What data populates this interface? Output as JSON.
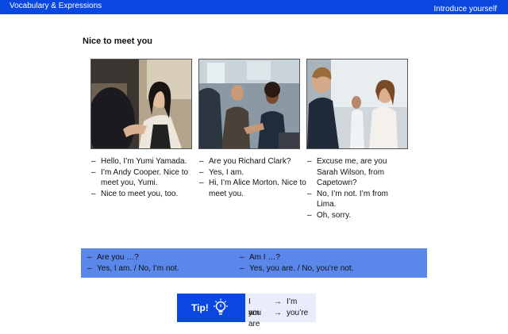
{
  "header": {
    "section_title": "Vocabulary & Expressions",
    "lesson_title": "Introduce yourself"
  },
  "heading": "Nice to meet you",
  "colors": {
    "brand": "#0a47e0",
    "grammar_bg": "#5b87ea",
    "tip_bg": "#e9edfb"
  },
  "dialogues": [
    {
      "lines": [
        "Hello, I’m Yumi Yamada.",
        "I’m Andy Cooper. Nice to meet you, Yumi.",
        "Nice to meet you, too."
      ]
    },
    {
      "lines": [
        "Are you Richard Clark?",
        "Yes, I am.",
        "Hi, I’m Alice Morton. Nice to meet you."
      ]
    },
    {
      "lines": [
        "Excuse me, are you Sarah Wilson, from Capetown?",
        "No, I’m not. I’m from Lima.",
        "Oh, sorry."
      ]
    }
  ],
  "grammar": {
    "left": [
      "Are you …?",
      "Yes, I am. / No, I’m not."
    ],
    "right": [
      "Am I …?",
      "Yes, you are. / No, you’re not."
    ]
  },
  "tip": {
    "label": "Tip!",
    "icon": "lightbulb-icon",
    "rows": [
      {
        "from": "I am",
        "arrow": "→",
        "to": "I’m"
      },
      {
        "from": "you are",
        "arrow": "→",
        "to": "you’re"
      }
    ]
  },
  "dash": "–"
}
